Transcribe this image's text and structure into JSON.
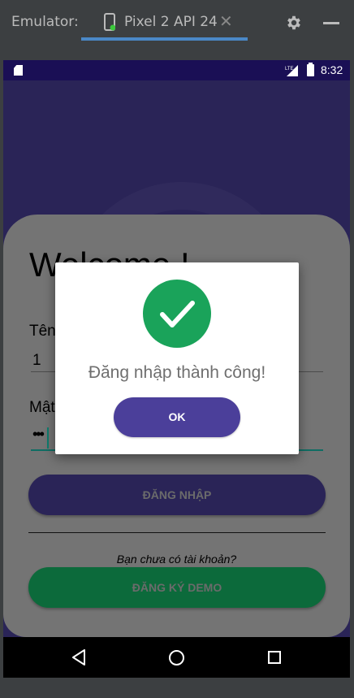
{
  "emulator": {
    "label": "Emulator:",
    "tab_title": "Pixel 2 API 24",
    "close_glyph": "✕",
    "icons": [
      "device-icon",
      "gear-icon",
      "minimize-icon"
    ]
  },
  "status_bar": {
    "time": "8:32",
    "network": "LTE"
  },
  "login_screen": {
    "welcome": "Welcome !",
    "username_label": "Tên",
    "username_value": "1",
    "password_label": "Mật",
    "password_value": "•••",
    "login_button": "ĐĂNG NHẬP",
    "no_account_text": "Bạn chưa có tài khoản?",
    "register_button": "ĐĂNG KÝ DEMO"
  },
  "dialog": {
    "message": "Đăng nhập thành công!",
    "ok_button": "OK",
    "icon": "check-circle-icon",
    "success_color": "#1aa35a",
    "button_color": "#4b3f9a"
  },
  "nav_bar": {
    "icons": [
      "back-icon",
      "home-icon",
      "recent-apps-icon"
    ]
  },
  "colors": {
    "background": "#2a2457",
    "status_bar": "#1a0f55",
    "register": "#0c6a3b"
  }
}
